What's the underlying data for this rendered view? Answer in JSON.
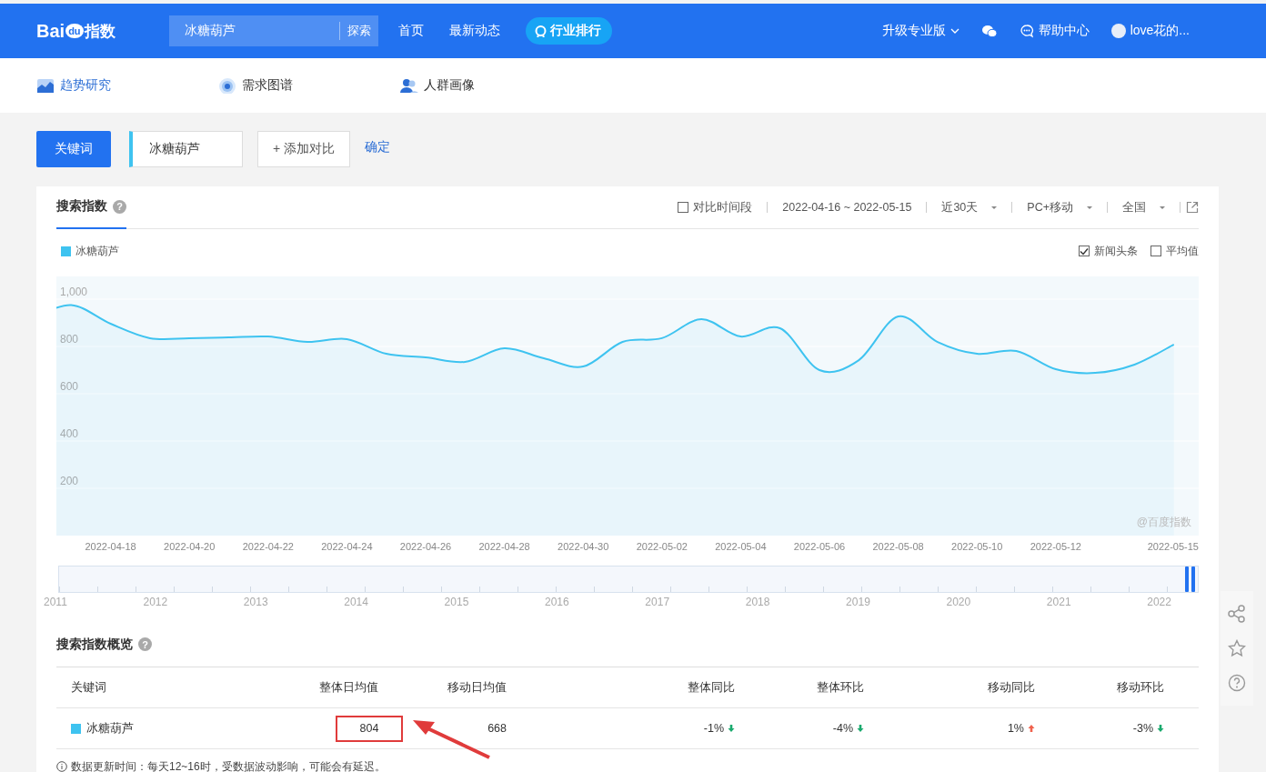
{
  "header": {
    "logo": {
      "text": "Bai",
      "badge": "du",
      "suffix": "指数"
    },
    "search": {
      "value": "冰糖葫芦",
      "button": "探索"
    },
    "nav": [
      {
        "label": "首页",
        "kind": "link"
      },
      {
        "label": "最新动态",
        "kind": "link"
      },
      {
        "label": "行业排行",
        "kind": "pill"
      }
    ],
    "upgrade": "升级专业版",
    "help": "帮助中心",
    "user": "love花的..."
  },
  "subnav": [
    {
      "label": "趋势研究",
      "selected": true,
      "kind": "trend"
    },
    {
      "label": "需求图谱",
      "selected": false,
      "kind": "graph"
    },
    {
      "label": "人群画像",
      "selected": false,
      "kind": "people"
    }
  ],
  "keyword_bar": {
    "label": "关键词",
    "keywords": [
      "冰糖葫芦"
    ],
    "add": "+ 添加对比",
    "confirm": "确定"
  },
  "trend": {
    "tab": "搜索指数",
    "help_mark": "?",
    "compare": {
      "label": "对比时间段",
      "checked": false
    },
    "date_range": "2022-04-16 ~ 2022-05-15",
    "dropdowns": [
      "近30天",
      "PC+移动",
      "全国"
    ],
    "options": [
      {
        "label": "新闻头条",
        "checked": true
      },
      {
        "label": "平均值",
        "checked": false
      }
    ],
    "credit": "@百度指数",
    "chart_data": {
      "type": "area",
      "grid": true,
      "categories": [
        null,
        null,
        "2022-04-18",
        null,
        "2022-04-20",
        null,
        "2022-04-22",
        null,
        "2022-04-24",
        null,
        "2022-04-26",
        null,
        "2022-04-28",
        null,
        "2022-04-30",
        null,
        "2022-05-02",
        null,
        "2022-05-04",
        null,
        "2022-05-06",
        null,
        "2022-05-08",
        null,
        "2022-05-10",
        null,
        "2022-05-12",
        null,
        null,
        "2022-05-15"
      ],
      "series": [
        {
          "name": "冰糖葫芦",
          "color": "#3ec3f0",
          "values": [
            920,
            975,
            896,
            835,
            835,
            838,
            842,
            819,
            831,
            769,
            754,
            735,
            792,
            750,
            715,
            819,
            835,
            915,
            842,
            877,
            700,
            742,
            927,
            819,
            769,
            781,
            704,
            688,
            723,
            808
          ]
        }
      ],
      "ylim": [
        0,
        1000
      ],
      "yticks": [
        {
          "value": 200,
          "label": "200"
        },
        {
          "value": 400,
          "label": "400"
        },
        {
          "value": 600,
          "label": "600"
        },
        {
          "value": 800,
          "label": "800"
        },
        {
          "value": 1000,
          "label": "1,000"
        }
      ]
    },
    "timeline": {
      "level": 1,
      "years": [
        "2011",
        "2012",
        "2013",
        "2014",
        "2015",
        "2016",
        "2017",
        "2018",
        "2019",
        "2020",
        "2021",
        "2022"
      ]
    }
  },
  "overview": {
    "title": "搜索指数概览",
    "help_mark": "?",
    "columns": [
      "关键词",
      "整体日均值",
      "移动日均值",
      "整体同比",
      "整体环比",
      "移动同比",
      "移动环比"
    ],
    "rows": [
      {
        "cells": [
          {
            "text": "冰糖葫芦",
            "kind": "keyword",
            "color": "#3ec3f0"
          },
          {
            "text": "804",
            "highlighted": true
          },
          {
            "text": "668",
            "highlighted": false
          },
          {
            "text": "-1%",
            "kind": "down"
          },
          {
            "text": "-4%",
            "kind": "down"
          },
          {
            "text": "1%",
            "kind": "up"
          },
          {
            "text": "-3%",
            "kind": "down"
          }
        ]
      }
    ],
    "note": "数据更新时间：每天12~16时，受数据波动影响，可能会有延迟。"
  }
}
